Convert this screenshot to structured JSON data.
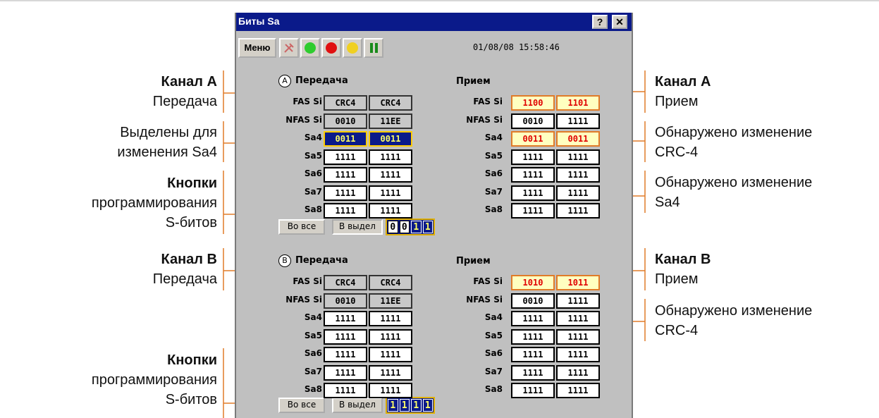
{
  "window": {
    "title": "Биты Sa",
    "help_btn": "?",
    "close_btn": "✕",
    "menu_label": "Меню",
    "datetime": "01/08/08 15:58:46"
  },
  "toolbar": {
    "icons": [
      "tools-icon",
      "green-light-icon",
      "red-light-icon",
      "yellow-light-icon",
      "pause-icon"
    ]
  },
  "row_labels": [
    "FAS Si",
    "NFAS Si",
    "Sa4",
    "Sa5",
    "Sa6",
    "Sa7",
    "Sa8"
  ],
  "channel_a": {
    "badge": "A",
    "tx_title": "Передача",
    "rx_title": "Прием",
    "tx": [
      [
        "CRC4",
        "CRC4"
      ],
      [
        "0010",
        "11EE"
      ],
      [
        "0011",
        "0011"
      ],
      [
        "1111",
        "1111"
      ],
      [
        "1111",
        "1111"
      ],
      [
        "1111",
        "1111"
      ],
      [
        "1111",
        "1111"
      ]
    ],
    "rx": [
      [
        "1100",
        "1101"
      ],
      [
        "0010",
        "1111"
      ],
      [
        "0011",
        "0011"
      ],
      [
        "1111",
        "1111"
      ],
      [
        "1111",
        "1111"
      ],
      [
        "1111",
        "1111"
      ],
      [
        "1111",
        "1111"
      ]
    ],
    "btn_all": "Во все",
    "btn_sel": "В выдел",
    "bits": [
      "0",
      "0",
      "1",
      "1"
    ]
  },
  "channel_b": {
    "badge": "B",
    "tx_title": "Передача",
    "rx_title": "Прием",
    "tx": [
      [
        "CRC4",
        "CRC4"
      ],
      [
        "0010",
        "11EE"
      ],
      [
        "1111",
        "1111"
      ],
      [
        "1111",
        "1111"
      ],
      [
        "1111",
        "1111"
      ],
      [
        "1111",
        "1111"
      ],
      [
        "1111",
        "1111"
      ]
    ],
    "rx": [
      [
        "1010",
        "1011"
      ],
      [
        "0010",
        "1111"
      ],
      [
        "1111",
        "1111"
      ],
      [
        "1111",
        "1111"
      ],
      [
        "1111",
        "1111"
      ],
      [
        "1111",
        "1111"
      ],
      [
        "1111",
        "1111"
      ]
    ],
    "btn_all": "Во все",
    "btn_sel": "В выдел",
    "bits": [
      "1",
      "1",
      "1",
      "1"
    ]
  },
  "annotations_left": {
    "a_tx_bold": "Канал A",
    "a_tx": "Передача",
    "sel_1": "Выделены для",
    "sel_2": "изменения Sa4",
    "btns1_bold": "Кнопки",
    "btns1_2": "программирования",
    "btns1_3": "S-битов",
    "b_tx_bold": "Канал B",
    "b_tx": "Передача",
    "btns2_bold": "Кнопки",
    "btns2_2": "программирования",
    "btns2_3": "S-битов"
  },
  "annotations_right": {
    "a_rx_bold": "Канал A",
    "a_rx": "Прием",
    "crc_a_1": "Обнаружено изменение",
    "crc_a_2": "CRC-4",
    "sa4_1": "Обнаружено изменение",
    "sa4_2": "Sa4",
    "b_rx_bold": "Канал B",
    "b_rx": "Прием",
    "crc_b_1": "Обнаружено изменение",
    "crc_b_2": "CRC-4"
  },
  "colors": {
    "accent_line": "#e07b28",
    "title_bg": "#0a1a8a",
    "window_bg": "#c0c0c0"
  }
}
